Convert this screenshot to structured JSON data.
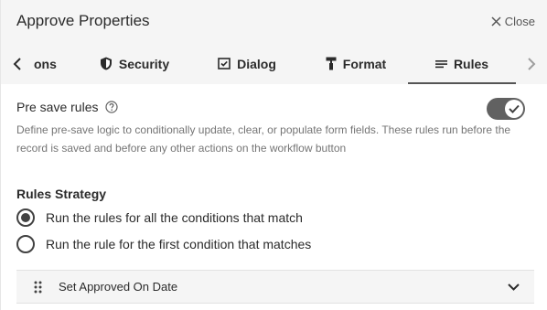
{
  "dialog": {
    "title": "Approve Properties",
    "close_label": "Close"
  },
  "tabs": [
    {
      "label": "ons",
      "icon": "partial-tab",
      "active": false
    },
    {
      "label": "Security",
      "icon": "shield-icon",
      "active": false
    },
    {
      "label": "Dialog",
      "icon": "checkbox-window-icon",
      "active": false
    },
    {
      "label": "Format",
      "icon": "paint-roller-icon",
      "active": false
    },
    {
      "label": "Rules",
      "icon": "rules-list-icon",
      "active": true
    }
  ],
  "presave": {
    "label": "Pre save rules",
    "enabled": true,
    "description": "Define pre-save logic to conditionally update, clear, or populate form fields. These rules run before the record is saved and before any other actions on the workflow button"
  },
  "strategy": {
    "title": "Rules Strategy",
    "options": [
      {
        "label": "Run the rules for all the conditions that match",
        "selected": true
      },
      {
        "label": "Run the rule for the first condition that matches",
        "selected": false
      }
    ]
  },
  "rules": [
    {
      "label": "Set Approved On Date",
      "expanded": false
    }
  ],
  "colors": {
    "header_bg": "#f5f5f5",
    "toggle_on": "#616161",
    "text_primary": "#2b2b2b",
    "text_secondary": "#757575"
  }
}
